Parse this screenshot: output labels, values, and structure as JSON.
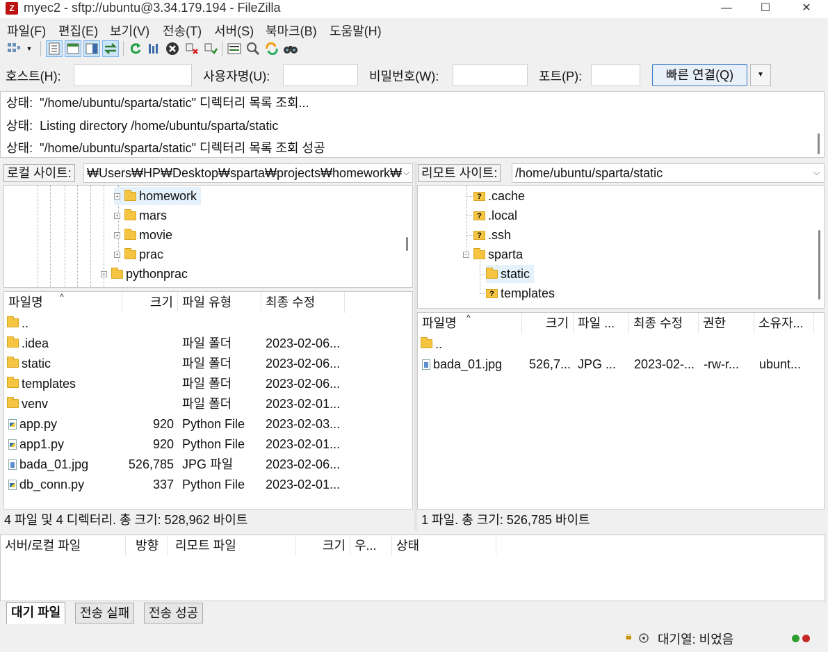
{
  "window": {
    "title": "myec2 - sftp://ubuntu@3.34.179.194 - FileZilla",
    "app_icon": "Z",
    "controls": [
      "—",
      "☐",
      "✕"
    ]
  },
  "menu": [
    "파일(F)",
    "편집(E)",
    "보기(V)",
    "전송(T)",
    "서버(S)",
    "북마크(B)",
    "도움말(H)"
  ],
  "quickconnect": {
    "host_label": "호스트(H):",
    "user_label": "사용자명(U):",
    "pass_label": "비밀번호(W):",
    "port_label": "포트(P):",
    "host_value": "",
    "user_value": "",
    "pass_value": "",
    "port_value": "",
    "connect_label": "빠른 연결(Q)",
    "dropdown_glyph": "▼"
  },
  "log": [
    {
      "prefix": "상태:",
      "text": "\"/home/ubuntu/sparta/static\" 디렉터리 목록 조회..."
    },
    {
      "prefix": "상태:",
      "text": "Listing directory /home/ubuntu/sparta/static"
    },
    {
      "prefix": "상태:",
      "text": "\"/home/ubuntu/sparta/static\" 디렉터리 목록 조회 성공"
    }
  ],
  "local": {
    "site_label": "로컬 사이트:",
    "path": "₩Users₩HP₩Desktop₩sparta₩projects₩homework₩",
    "tree": [
      {
        "name": "homework",
        "selected": true
      },
      {
        "name": "mars",
        "selected": false
      },
      {
        "name": "movie",
        "selected": false
      },
      {
        "name": "prac",
        "selected": false
      },
      {
        "name": "pythonprac",
        "selected": false
      }
    ],
    "columns": {
      "name": "파일명",
      "size": "크기",
      "type": "파일 유형",
      "modified": "최종 수정"
    },
    "files": [
      {
        "name": "..",
        "size": "",
        "type": "",
        "modified": "",
        "kind": "folder"
      },
      {
        "name": ".idea",
        "size": "",
        "type": "파일 폴더",
        "modified": "2023-02-06...",
        "kind": "folder"
      },
      {
        "name": "static",
        "size": "",
        "type": "파일 폴더",
        "modified": "2023-02-06...",
        "kind": "folder"
      },
      {
        "name": "templates",
        "size": "",
        "type": "파일 폴더",
        "modified": "2023-02-06...",
        "kind": "folder"
      },
      {
        "name": "venv",
        "size": "",
        "type": "파일 폴더",
        "modified": "2023-02-01...",
        "kind": "folder"
      },
      {
        "name": "app.py",
        "size": "920",
        "type": "Python File",
        "modified": "2023-02-03...",
        "kind": "py"
      },
      {
        "name": "app1.py",
        "size": "920",
        "type": "Python File",
        "modified": "2023-02-01...",
        "kind": "py"
      },
      {
        "name": "bada_01.jpg",
        "size": "526,785",
        "type": "JPG 파일",
        "modified": "2023-02-06...",
        "kind": "img"
      },
      {
        "name": "db_conn.py",
        "size": "337",
        "type": "Python File",
        "modified": "2023-02-01...",
        "kind": "py"
      }
    ],
    "status": "4 파일 및 4 디렉터리. 총 크기: 528,962 바이트"
  },
  "remote": {
    "site_label": "리모트 사이트:",
    "path": "/home/ubuntu/sparta/static",
    "tree": [
      {
        "name": ".cache",
        "unknown": true,
        "selected": false
      },
      {
        "name": ".local",
        "unknown": true,
        "selected": false
      },
      {
        "name": ".ssh",
        "unknown": true,
        "selected": false
      },
      {
        "name": "sparta",
        "unknown": false,
        "selected": false
      },
      {
        "name": "static",
        "unknown": false,
        "selected": true
      },
      {
        "name": "templates",
        "unknown": true,
        "selected": false
      }
    ],
    "columns": {
      "name": "파일명",
      "size": "크기",
      "type": "파일 ...",
      "modified": "최종 수정",
      "perm": "권한",
      "owner": "소유자..."
    },
    "files": [
      {
        "name": "..",
        "size": "",
        "type": "",
        "modified": "",
        "perm": "",
        "owner": "",
        "kind": "folder"
      },
      {
        "name": "bada_01.jpg",
        "size": "526,7...",
        "type": "JPG ...",
        "modified": "2023-02-...",
        "perm": "-rw-r...",
        "owner": "ubunt...",
        "kind": "img"
      }
    ],
    "status": "1 파일. 총 크기: 526,785 바이트"
  },
  "queue": {
    "columns": {
      "file": "서버/로컬 파일",
      "dir": "방향",
      "remote": "리모트 파일",
      "size": "크기",
      "prio": "우...",
      "status": "상태"
    }
  },
  "tabs": [
    "대기 파일",
    "전송 실패",
    "전송 성공"
  ],
  "bottom": {
    "queue_status": "대기열: 비었음"
  },
  "colors": {
    "led_green": "#2e9e2e",
    "led_red": "#c62828",
    "folder": "#f5c542",
    "accent": "#3b78c6"
  }
}
